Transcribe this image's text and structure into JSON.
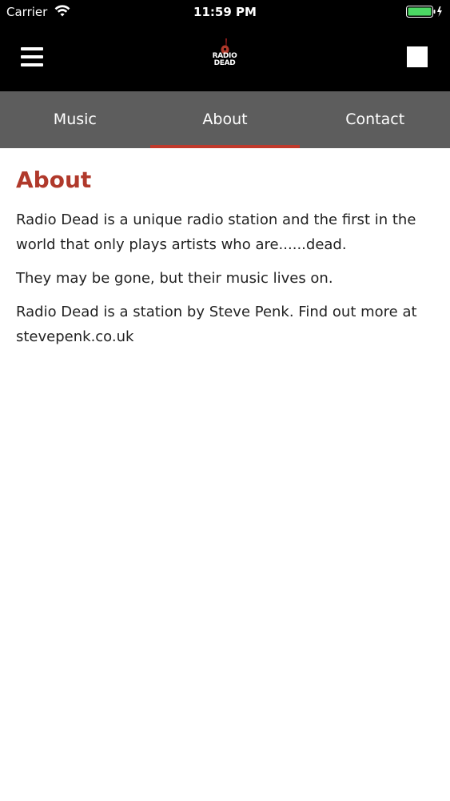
{
  "status_bar": {
    "carrier": "Carrier",
    "time": "11:59 PM"
  },
  "header": {
    "logo_line1": "RADIO",
    "logo_line2": "DEAD",
    "menu_icon": "hamburger-menu-icon",
    "stop_icon": "stop-square-icon"
  },
  "tabs": [
    {
      "label": "Music",
      "active": false
    },
    {
      "label": "About",
      "active": true
    },
    {
      "label": "Contact",
      "active": false
    }
  ],
  "content": {
    "title": "About",
    "paragraphs": [
      "Radio Dead is a unique radio station and the first in the world that only plays artists who are......dead.",
      "They may be gone, but their music lives on.",
      "Radio Dead is a station by Steve Penk. Find out more at stevepenk.co.uk"
    ]
  },
  "colors": {
    "accent": "#b0392b",
    "tab_bar": "#5d5d5d",
    "header": "#000000",
    "battery": "#4cd964"
  }
}
